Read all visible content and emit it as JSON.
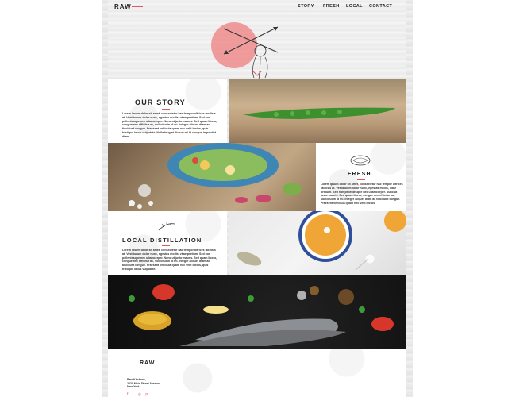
{
  "brand": {
    "logo": "RAW"
  },
  "nav": {
    "items": [
      "STORY",
      "FRESH",
      "LOCAL",
      "CONTACT"
    ]
  },
  "story": {
    "title": "OUR STORY",
    "body": "Lorem ipsum dolor sit amet, consectetur hac tempor ultrices facilisis at. Vestibulum dolor nunc, egestas mollis, vitae pretium. Sed non pellentesque nec ullamcorper. Nunc ut justo mauris. Sed quam libero, congue nec efficitur ac, sollicitudin id mi. Integer aliquet diam ac tincidunt congue. Praesent vehicula quam nec velit luctus, quis tristique lacus vulputate. Nulla feugiat dictum mi id congue imperdiet diam."
  },
  "fresh": {
    "title": "FRESH",
    "body": "Lorem ipsum dolor sit amet, consectetur hac tempor ultrices facilisis at. Vestibulum dolor nunc, egestas mollis, vitae pretium. Sed non pellentesque nec ullamcorper. Nunc ut justo mauris. Sed quam libero, congue nec efficitur ac, sollicitudin id mi. Integer aliquet diam ac tincidunt congue. Praesent vehicula quam nec velit luctus."
  },
  "local": {
    "title": "LOCAL DISTILLATION",
    "body": "Lorem ipsum dolor sit amet, consectetur hac tempor ultrices facilisis at. Vestibulum dolor nunc, egestas mollis, vitae pretium. Sed non pellentesque nec ullamcorper. Nunc ut justo mauris. Sed quam libero, congue nec efficitur ac, sollicitudin id mi. Integer aliquet diam ac tincidunt congue. Praesent vehicula quam nec velit luctus, quis tristique lacus vulputate."
  },
  "footer": {
    "logo": "RAW",
    "address": "Raw Kitchens,\n2020 Main Street Avenue,\nNew York",
    "social_icons": [
      "facebook-icon",
      "twitter-icon",
      "instagram-icon",
      "pinterest-icon"
    ]
  },
  "colors": {
    "accent": "#e05a5a",
    "text": "#222222"
  }
}
